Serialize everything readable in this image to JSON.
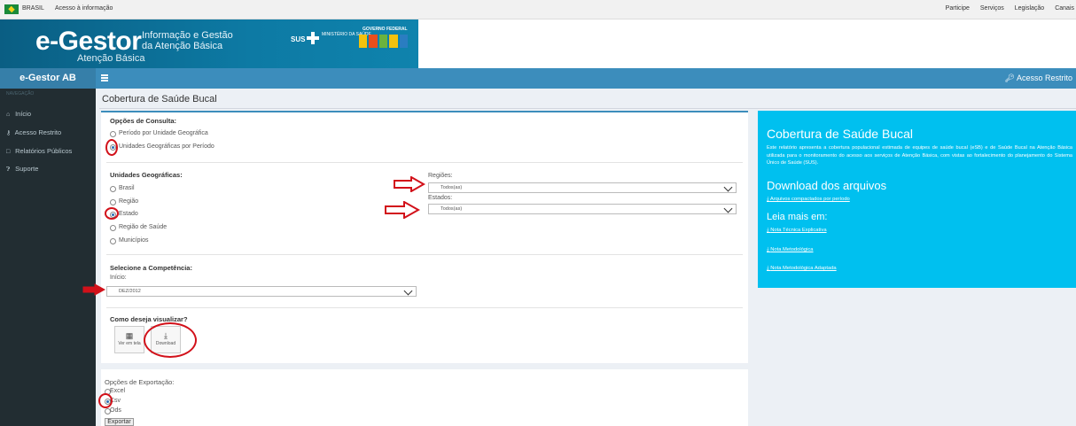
{
  "gov_bar": {
    "country": "BRASIL",
    "access_info": "Acesso à informação",
    "links": [
      "Participe",
      "Serviços",
      "Legislação",
      "Canais"
    ]
  },
  "header": {
    "logo": "e-Gestor",
    "logo_sub": "Atenção Básica",
    "tagline_1": "Informação e Gestão",
    "tagline_2": "da Atenção Básica",
    "sus": "SUS",
    "ministerio": "MINISTÉRIO DA SAÚDE",
    "governo": "GOVERNO FEDERAL"
  },
  "topnav": {
    "brand": "e-Gestor AB",
    "restricted": "Acesso Restrito"
  },
  "sidebar": {
    "header": "NAVEGAÇÃO",
    "items": [
      {
        "label": "Início",
        "icon": "home-icon"
      },
      {
        "label": "Acesso Restrito",
        "icon": "key-icon"
      },
      {
        "label": "Relatórios Públicos",
        "icon": "monitor-icon"
      },
      {
        "label": "Suporte",
        "icon": "help-icon"
      }
    ]
  },
  "page": {
    "title": "Cobertura de Saúde Bucal"
  },
  "consulta": {
    "title": "Opções de Consulta:",
    "options": [
      "Período por Unidade Geográfica",
      "Unidades Geográficas por Período"
    ],
    "selected": "Unidades Geográficas por Período"
  },
  "unidades": {
    "title": "Unidades Geográficas:",
    "options": [
      "Brasil",
      "Região",
      "Estado",
      "Região de Saúde",
      "Municípios"
    ],
    "selected": "Estado"
  },
  "regioes": {
    "label": "Regiões:",
    "value": "Todos(as)"
  },
  "estados": {
    "label": "Estados:",
    "value": "Todos(as)"
  },
  "competencia": {
    "title": "Selecione a Competência:",
    "inicio_label": "Início:",
    "inicio_value": "DEZ/2012"
  },
  "visualizar": {
    "title": "Como deseja visualizar?",
    "ver_em_tela": "Ver em tela",
    "download": "Download"
  },
  "exportacao": {
    "title": "Opções de Exportação:",
    "options": [
      "Excel",
      "Csv",
      "Ods"
    ],
    "selected": "Csv",
    "button": "Exportar"
  },
  "info": {
    "title": "Cobertura de Saúde Bucal",
    "description": "Este relatório apresenta a cobertura populacional estimada de equipes de saúde bucal (eSB) e de Saúde Bucal na Atenção Básica utilizada para o monitoramento do acesso aos serviços de Atenção Básica, com vistas ao fortalecimento do planejamento do Sistema Único de Saúde (SUS).",
    "download_title": "Download dos arquivos",
    "download_link": "Arquivos compactados por período",
    "more_title": "Leia mais em:",
    "links": [
      "Nota Técnica Explicativa",
      "Nota Metodológica",
      "Nota Metodológica Adaptada"
    ]
  },
  "colors": {
    "header_blue": "#0d7aa4",
    "nav_blue": "#3c8dbc",
    "sidebar_dark": "#222d32",
    "info_cyan": "#00c0ef",
    "annotation_red": "#d2111a"
  }
}
